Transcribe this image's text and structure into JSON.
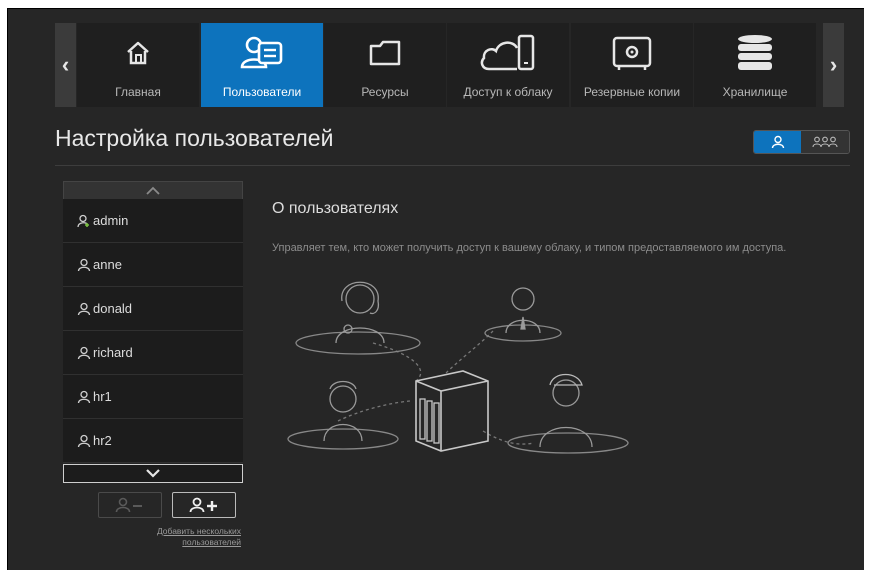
{
  "nav": {
    "items": [
      {
        "label": "Главная",
        "icon": "home-icon"
      },
      {
        "label": "Пользователи",
        "icon": "users-icon",
        "active": true
      },
      {
        "label": "Ресурсы",
        "icon": "folder-icon"
      },
      {
        "label": "Доступ к облаку",
        "icon": "cloud-access-icon"
      },
      {
        "label": "Резервные копии",
        "icon": "safe-icon"
      },
      {
        "label": "Хранилище",
        "icon": "storage-icon"
      }
    ],
    "prev_icon": "chevron-left-icon",
    "next_icon": "chevron-right-icon"
  },
  "page": {
    "title": "Настройка пользователей"
  },
  "view_toggle": {
    "single_icon": "single-user-icon",
    "multi_icon": "multi-user-icon",
    "active": "single"
  },
  "users": [
    {
      "name": "admin",
      "admin": true
    },
    {
      "name": "anne"
    },
    {
      "name": "donald"
    },
    {
      "name": "richard"
    },
    {
      "name": "hr1"
    },
    {
      "name": "hr2"
    }
  ],
  "actions": {
    "add_multiple_line1": "Добавить нескольких",
    "add_multiple_line2": "пользователей"
  },
  "about": {
    "title": "О пользователях",
    "description": "Управляет тем, кто может получить доступ к вашему облаку, и типом предоставляемого им доступа."
  },
  "colors": {
    "accent": "#0d73bd",
    "background": "#262626",
    "admin_icon": "#7bc043"
  }
}
